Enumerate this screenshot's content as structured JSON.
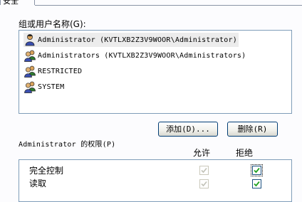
{
  "tab": {
    "label": "安全"
  },
  "groups": {
    "label": "组或用户名称(G):",
    "items": [
      {
        "label": "Administrator (KVTLXB2Z3V9WOOR\\Administrator)",
        "selected": true,
        "icon": "user-icon"
      },
      {
        "label": "Administrators (KVTLXB2Z3V9WOOR\\Administrators)",
        "selected": false,
        "icon": "group-icon"
      },
      {
        "label": "RESTRICTED",
        "selected": false,
        "icon": "group-icon"
      },
      {
        "label": "SYSTEM",
        "selected": false,
        "icon": "group-icon"
      }
    ],
    "add_button": "添加(D)...",
    "remove_button": "删除(R)"
  },
  "permissions": {
    "label": "Administrator 的权限(P)",
    "allow_header": "允许",
    "deny_header": "拒绝",
    "rows": [
      {
        "name": "完全控制",
        "allow": true,
        "allow_disabled": true,
        "deny": true,
        "deny_disabled": false
      },
      {
        "name": "读取",
        "allow": true,
        "allow_disabled": true,
        "deny": true,
        "deny_disabled": false
      }
    ]
  },
  "colors": {
    "check_green": "#21a121",
    "check_gray": "#c2c2b8",
    "border_blue": "#7f9db9"
  }
}
